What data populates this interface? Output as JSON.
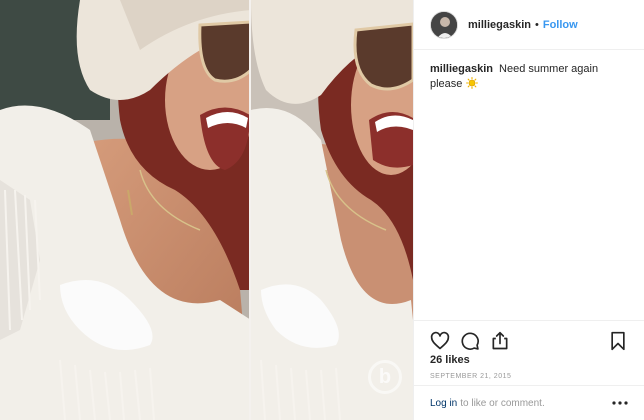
{
  "post": {
    "username": "milliegaskin",
    "separator": "•",
    "follow_label": "Follow",
    "caption_user": "milliegaskin",
    "caption_text": "Need summer again please",
    "caption_emoji": "sun-emoji",
    "likes": "26 likes",
    "date": "September 21, 2015",
    "login_link": "Log in",
    "login_text": "to like or comment."
  },
  "icons": {
    "like": "heart-icon",
    "comment": "comment-icon",
    "share": "share-icon",
    "save": "bookmark-icon",
    "more": "more-icon"
  },
  "colors": {
    "follow": "#3897f0",
    "login_link": "#003569",
    "muted": "#999999",
    "text": "#262626"
  }
}
